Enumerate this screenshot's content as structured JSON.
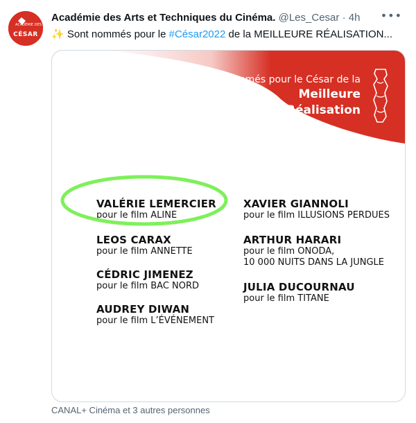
{
  "tweet": {
    "author": "Académie des Arts et Techniques du Cinéma.",
    "handle": "@Les_Cesar",
    "separator": "·",
    "time": "4h",
    "more_icon": "more-icon",
    "avatar": {
      "small_text": "ACADÉMIE DES",
      "brand": "CÉSAR"
    },
    "text": {
      "sparkle": "✨",
      "before": " Sont nommés pour le ",
      "hashtag": "#César2022",
      "after": " de la MEILLEURE RÉALISATION..."
    },
    "footer": "CANAL+ Cinéma et 3 autres personnes"
  },
  "card": {
    "subtitle": "nommés pour le César de la",
    "title_line1": "Meilleure",
    "title_line2": "Réalisation",
    "colors": {
      "brand_red": "#d62f24",
      "highlight_green": "#7ef05a"
    },
    "nominees_left": [
      {
        "name": "VALÉRIE LEMERCIER",
        "film": "pour le film ALINE",
        "highlighted": true
      },
      {
        "name": "LEOS CARAX",
        "film": "pour le film ANNETTE"
      },
      {
        "name": "CÉDRIC JIMENEZ",
        "film": "pour le film BAC NORD"
      },
      {
        "name": "AUDREY DIWAN",
        "film": "pour le film L’ÉVÉNEMENT"
      }
    ],
    "nominees_right": [
      {
        "name": "XAVIER GIANNOLI",
        "film": "pour le film ILLUSIONS PERDUES"
      },
      {
        "name": "ARTHUR HARARI",
        "film": "pour le film ONODA,",
        "film2": "10 000 NUITS DANS LA JUNGLE"
      },
      {
        "name": "JULIA DUCOURNAU",
        "film": "pour le film TITANE"
      }
    ]
  }
}
